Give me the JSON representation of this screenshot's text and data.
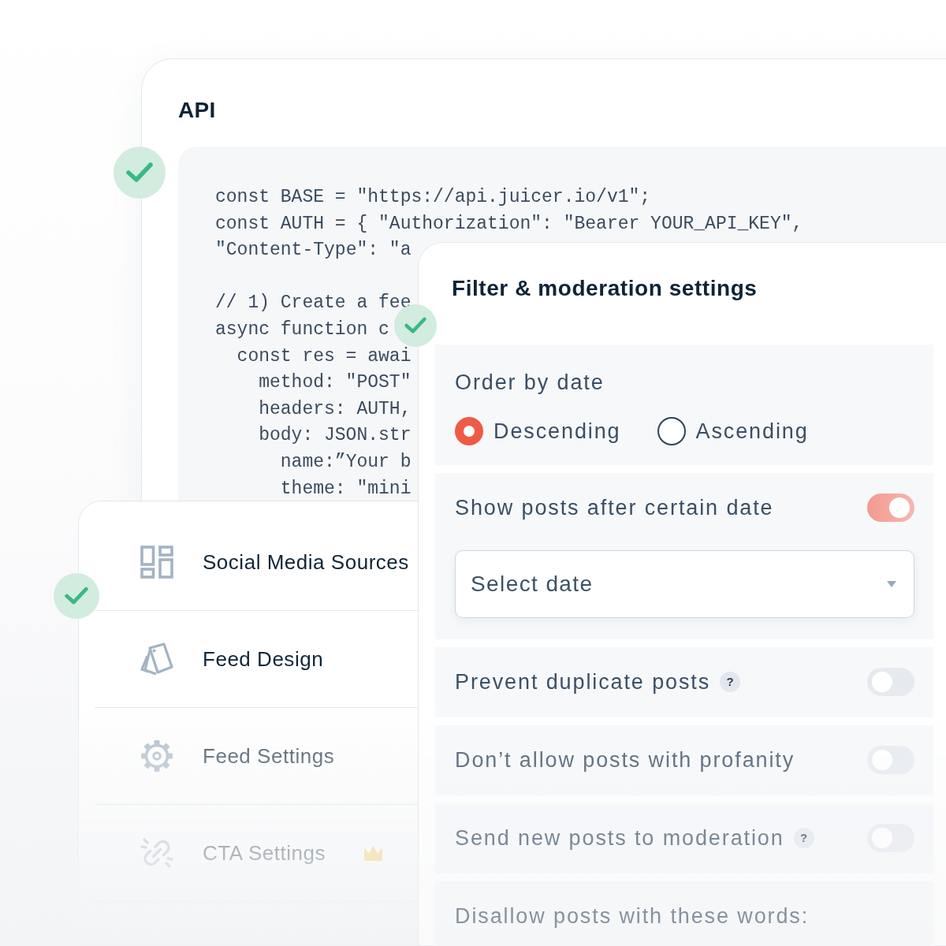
{
  "api_card": {
    "title": "API",
    "completed": true,
    "code_blocks": [
      [
        {
          "text": "const BASE = \"https://api.juicer.io/v1\";"
        },
        {
          "text": "const AUTH = { \"Authorization\": \"Bearer YOUR_API_KEY\","
        },
        {
          "text": "\"Content-Type\": \"a"
        }
      ],
      [
        {
          "text": "// 1) Create a fee"
        },
        {
          "text": "async function c",
          "children": [
            {
              "text": "const res = awai",
              "children": [
                {
                  "text": "method: \"POST\""
                },
                {
                  "text": "headers: AUTH,"
                },
                {
                  "text": "body: JSON.str",
                  "children": [
                    {
                      "text": "name:”Your b"
                    },
                    {
                      "text": "theme: \"mini"
                    }
                  ]
                }
              ]
            }
          ]
        }
      ]
    ]
  },
  "filter_panel": {
    "title": "Filter & moderation settings",
    "completed": true,
    "sections": [
      {
        "kind": "radio_group",
        "label": "Order by date",
        "options": [
          {
            "label": "Descending",
            "selected": true
          },
          {
            "label": "Ascending",
            "selected": false
          }
        ]
      },
      {
        "kind": "toggle",
        "label": "Show posts after certain date",
        "on": true,
        "select": {
          "placeholder": "Select date"
        }
      },
      {
        "kind": "toggle",
        "label": "Prevent duplicate posts",
        "help": "?",
        "on": false
      },
      {
        "kind": "toggle",
        "label": "Don’t allow posts with profanity",
        "on": false
      },
      {
        "kind": "toggle",
        "label": "Send new posts to moderation",
        "help": "?",
        "on": false
      },
      {
        "kind": "text",
        "label": "Disallow posts with these words:"
      }
    ]
  },
  "sidebar": {
    "completed": true,
    "items": [
      {
        "label": "Social Media Sources",
        "premium": false
      },
      {
        "label": "Feed Design",
        "premium": false
      },
      {
        "label": "Feed Settings",
        "premium": false
      },
      {
        "label": "CTA Settings",
        "premium": true
      }
    ]
  }
}
